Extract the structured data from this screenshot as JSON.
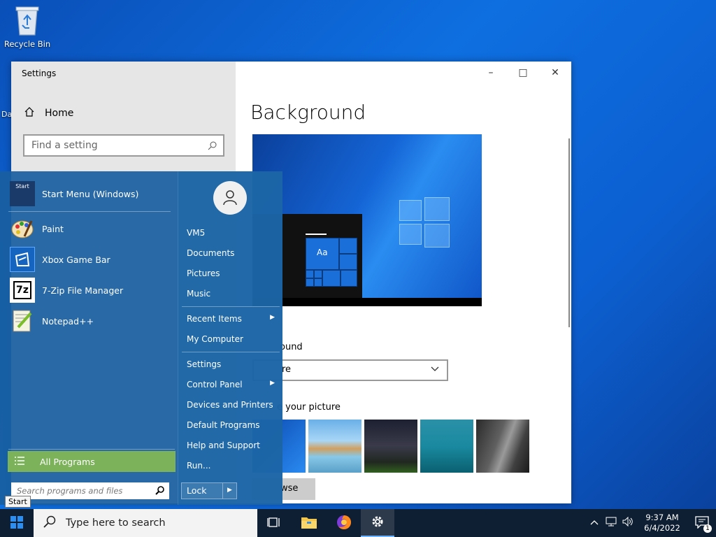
{
  "desktop": {
    "icons": [
      {
        "label": "Recycle Bin",
        "icon": "recycle-bin-icon"
      }
    ],
    "partial_label": "Da"
  },
  "settings": {
    "title": "Settings",
    "home_label": "Home",
    "search_placeholder": "Find a setting",
    "heading": "Background",
    "background_label": "ound",
    "background_value": "re",
    "choose_label": "e your picture",
    "browse_label": "wse",
    "preview_tile_text": "Aa"
  },
  "start_menu": {
    "pinned": [
      {
        "label": "Start Menu (Windows)",
        "icon": "start-menu-app-icon",
        "icon_text": "Start"
      }
    ],
    "recent": [
      {
        "label": "Paint",
        "icon": "paint-icon"
      },
      {
        "label": "Xbox Game Bar",
        "icon": "xbox-game-bar-icon"
      },
      {
        "label": "7-Zip File Manager",
        "icon": "7zip-icon",
        "icon_text": "7z"
      },
      {
        "label": "Notepad++",
        "icon": "notepadpp-icon"
      }
    ],
    "all_programs": "All Programs",
    "search_placeholder": "Search programs and files",
    "right_group1": [
      "VM5",
      "Documents",
      "Pictures",
      "Music"
    ],
    "right_group2": [
      {
        "label": "Recent Items",
        "submenu": true
      },
      {
        "label": "My Computer",
        "submenu": false
      }
    ],
    "right_group3": [
      {
        "label": "Settings",
        "submenu": false
      },
      {
        "label": "Control Panel",
        "submenu": true
      },
      {
        "label": "Devices and Printers",
        "submenu": false
      },
      {
        "label": "Default Programs",
        "submenu": false
      },
      {
        "label": "Help and Support",
        "submenu": false
      },
      {
        "label": "Run...",
        "submenu": false
      }
    ],
    "lock_label": "Lock",
    "tooltip": "Start"
  },
  "taskbar": {
    "search_placeholder": "Type here to search",
    "apps": [
      "task-view-icon",
      "file-explorer-icon",
      "firefox-icon",
      "settings-gear-icon"
    ],
    "time": "9:37 AM",
    "date": "6/4/2022",
    "notification_count": "1"
  }
}
